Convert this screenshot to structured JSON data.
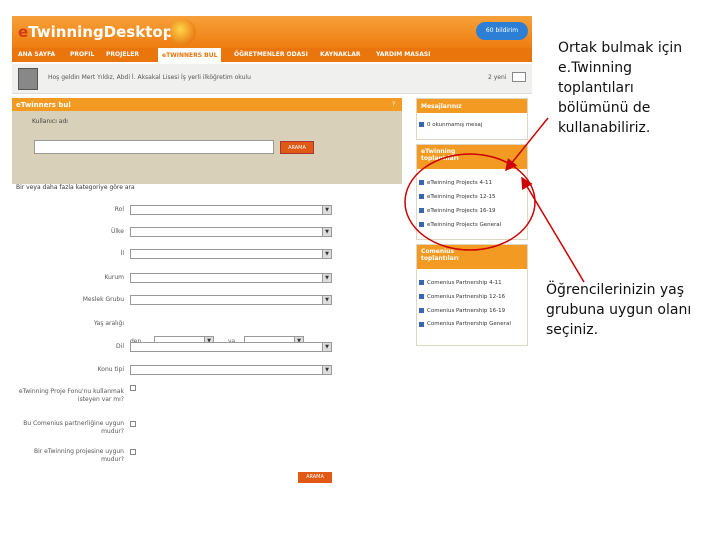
{
  "app": {
    "logo_e": "e",
    "logo_rest": "TwinningDesktop",
    "top_button": "60 bildirim"
  },
  "nav": {
    "items": [
      "ANA SAYFA",
      "PROFIL",
      "PROJELER",
      "eTWINNERS BUL",
      "ÖĞRETMENLER ODASI",
      "KAYNAKLAR",
      "YARDIM MASASI"
    ]
  },
  "welcome": {
    "text": "Hoş geldin Mert Yıldız, Abdi İ. Aksakal Lisesi İş yerli ilköğretim okulu",
    "count": "2 yeni"
  },
  "search": {
    "title": "eTwinners bul",
    "help": "?",
    "label": "Kullanıcı adı",
    "input_value": "",
    "button": "ARAMA"
  },
  "categories": {
    "title": "Bir veya daha fazla kategoriye göre ara",
    "fields": [
      "Rol",
      "Ülke",
      "İl",
      "Kurum",
      "Meslek Grubu",
      "Yaş aralığı",
      "Dil",
      "Konu tipi"
    ],
    "age_from": "den",
    "age_to": "ya",
    "checks": [
      "eTwinning Proje Fonu'nu kullanmak isteyen var mı?",
      "Bu Comenius partnerliğine uygun mudur?",
      "Bir eTwinning projesine uygun mudur?"
    ],
    "submit": "ARAMA"
  },
  "messages": {
    "title": "Mesajlarınız",
    "help": "?",
    "item": "0 okunmamış mesaj"
  },
  "etwinning_groups": {
    "title_line1": "eTwinning",
    "title_line2": "toplantıları",
    "items": [
      "eTwinning Projects 4-11",
      "eTwinning Projects 12-15",
      "eTwinning Projects 16-19",
      "eTwinning Projects General"
    ]
  },
  "comenius_groups": {
    "title_line1": "Comenius",
    "title_line2": "toplantıları",
    "help": "?",
    "items": [
      "Comenius Partnership 4-11",
      "Comenius Partnership 12-16",
      "Comenius Partnership 16-19",
      "Comenius Partnership General"
    ]
  },
  "annotations": {
    "top": "Ortak bulmak için e.Twinning toplantıları bölümünü de kullanabiliriz.",
    "bottom": "Öğrencilerinizin yaş grubuna uygun olanı seçiniz."
  },
  "colors": {
    "orange": "#f39a23",
    "arrow": "#cc0000"
  }
}
